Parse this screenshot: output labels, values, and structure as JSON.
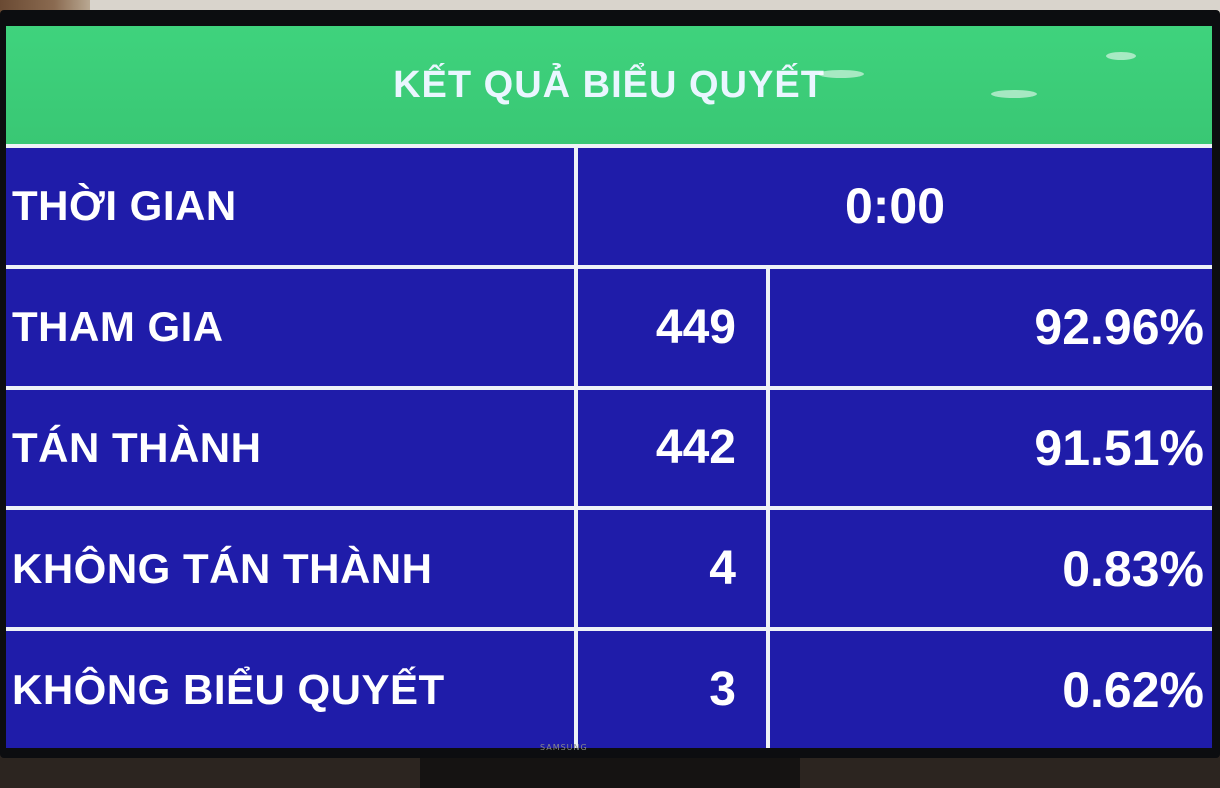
{
  "board": {
    "title": "KẾT QUẢ BIỂU QUYẾT",
    "time": {
      "label": "THỜI GIAN",
      "value": "0:00"
    },
    "rows": [
      {
        "label": "THAM GIA",
        "count": "449",
        "percent": "92.96%"
      },
      {
        "label": "TÁN THÀNH",
        "count": "442",
        "percent": "91.51%"
      },
      {
        "label": "KHÔNG TÁN THÀNH",
        "count": "4",
        "percent": "0.83%"
      },
      {
        "label": "KHÔNG BIỂU QUYẾT",
        "count": "3",
        "percent": "0.62%"
      }
    ]
  },
  "colors": {
    "title_bar": "#3fd37d",
    "cell_blue": "#1f1ca9",
    "grid_lines": "#eef2f7",
    "text": "#ffffff"
  },
  "device": {
    "logo": "SAMSUNG"
  }
}
